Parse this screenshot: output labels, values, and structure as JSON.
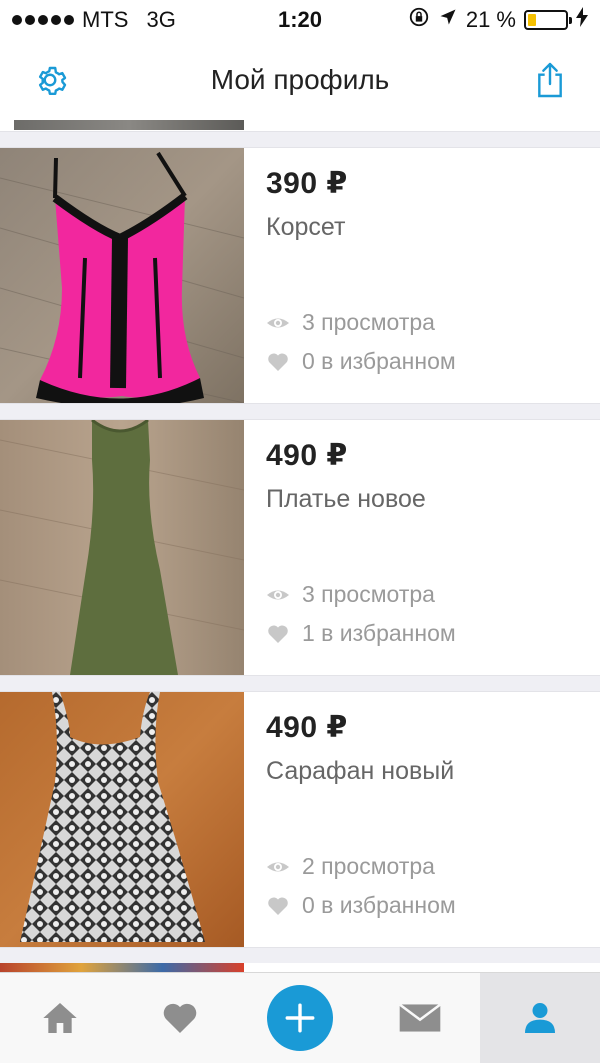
{
  "status_bar": {
    "carrier": "MTS",
    "network": "3G",
    "time": "1:20",
    "battery": "21 %",
    "battery_level": 0.21
  },
  "nav": {
    "title": "Мой профиль"
  },
  "listings": [
    {
      "price": "390 ₽",
      "title": "Корсет",
      "views": "3 просмотра",
      "favorites": "0 в избранном"
    },
    {
      "price": "490 ₽",
      "title": "Платье новое",
      "views": "3 просмотра",
      "favorites": "1 в избранном"
    },
    {
      "price": "490 ₽",
      "title": "Сарафан новый",
      "views": "2 просмотра",
      "favorites": "0 в избранном"
    }
  ],
  "tabs": [
    {
      "icon": "home-icon"
    },
    {
      "icon": "heart-icon"
    },
    {
      "icon": "plus-icon"
    },
    {
      "icon": "mail-icon"
    },
    {
      "icon": "profile-icon",
      "active": true
    }
  ],
  "colors": {
    "accent": "#1a9ad6",
    "stat_gray": "#9a9a9a",
    "battery_fill": "#f5c000"
  }
}
